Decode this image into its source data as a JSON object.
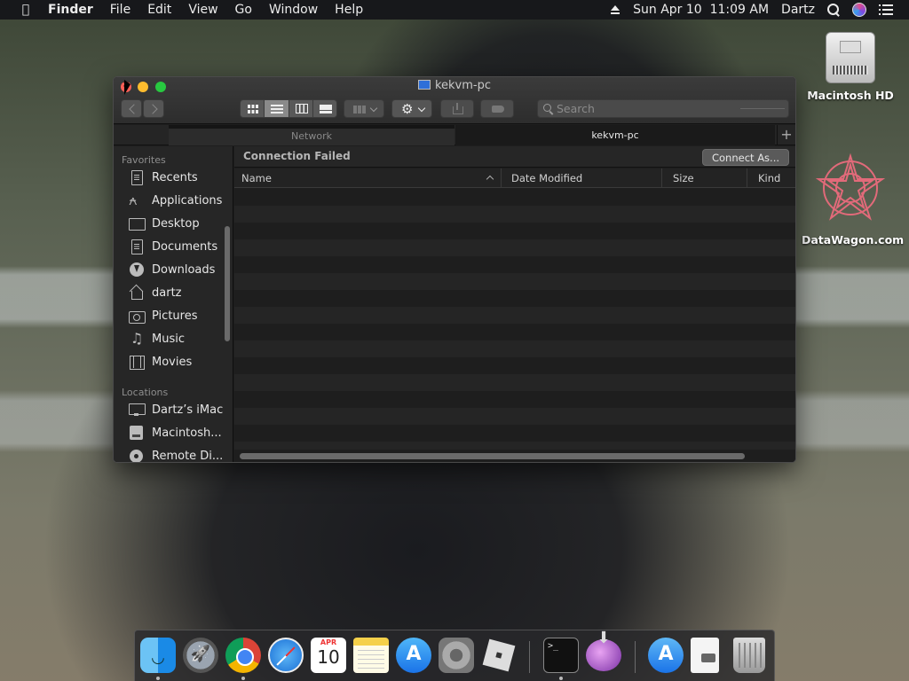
{
  "menubar": {
    "apple_icon": "apple-icon",
    "items": [
      "Finder",
      "File",
      "Edit",
      "View",
      "Go",
      "Window",
      "Help"
    ],
    "datetime": "Sun Apr 10  11:09 AM",
    "user": "Dartz"
  },
  "desktop": {
    "icons": [
      {
        "label": "Macintosh HD",
        "icon": "hard-drive-icon"
      },
      {
        "label": "DataWagon.com",
        "icon": "star-pattern-icon"
      }
    ]
  },
  "window": {
    "title": "kekvm-pc",
    "search": {
      "placeholder": "Search",
      "value": ""
    },
    "tabs": [
      {
        "label": "Network",
        "active": false
      },
      {
        "label": "kekvm-pc",
        "active": true
      }
    ],
    "add_tab_label": "+",
    "status": "Connection Failed",
    "connect_button": "Connect As...",
    "columns": {
      "name": "Name",
      "date": "Date Modified",
      "size": "Size",
      "kind": "Kind"
    }
  },
  "sidebar": {
    "favorites_heading": "Favorites",
    "favorites": [
      {
        "label": "Recents",
        "icon": "recents-icon"
      },
      {
        "label": "Applications",
        "icon": "applications-icon"
      },
      {
        "label": "Desktop",
        "icon": "desktop-folder-icon"
      },
      {
        "label": "Documents",
        "icon": "documents-icon"
      },
      {
        "label": "Downloads",
        "icon": "downloads-icon"
      },
      {
        "label": "dartz",
        "icon": "home-icon"
      },
      {
        "label": "Pictures",
        "icon": "pictures-icon"
      },
      {
        "label": "Music",
        "icon": "music-icon"
      },
      {
        "label": "Movies",
        "icon": "movies-icon"
      }
    ],
    "locations_heading": "Locations",
    "locations": [
      {
        "label": "Dartz’s iMac",
        "icon": "imac-icon"
      },
      {
        "label": "Macintosh...",
        "icon": "hard-disk-icon"
      },
      {
        "label": "Remote Di...",
        "icon": "remote-disc-icon"
      }
    ]
  },
  "dock": {
    "calendar_month": "APR",
    "calendar_day": "10"
  }
}
